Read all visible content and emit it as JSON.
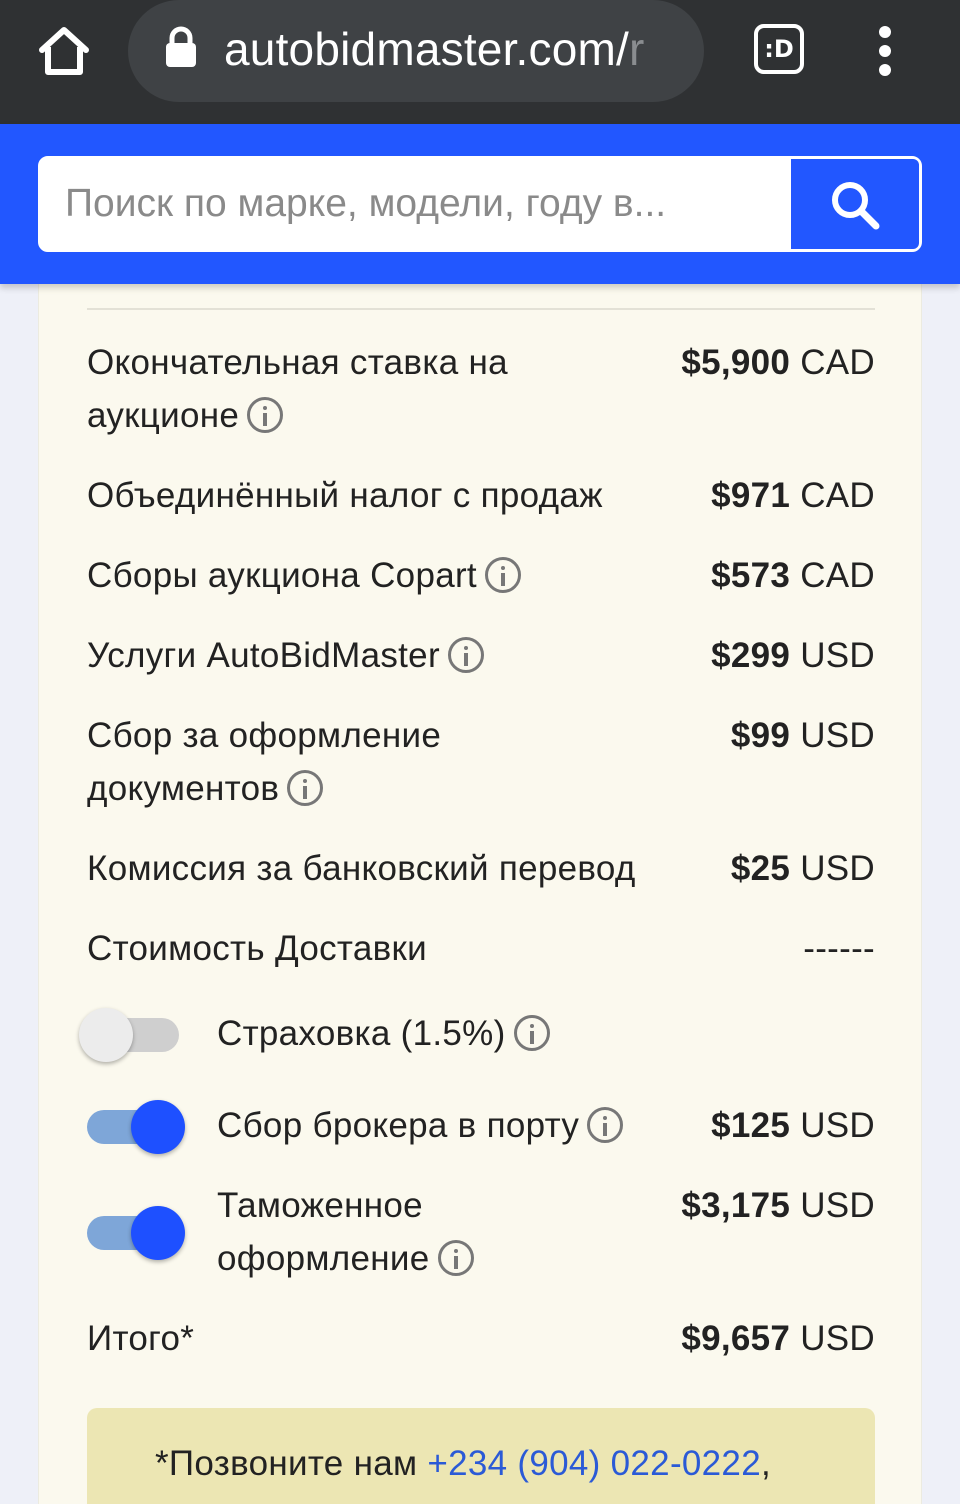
{
  "browser": {
    "url_main": "autobidmaster.com/",
    "url_fade": "r",
    "tabs_label": ":D"
  },
  "search": {
    "placeholder": "Поиск по марке, модели, году в..."
  },
  "costs": {
    "rows": [
      {
        "label": "Окончательная ставка на аукционе",
        "amount": "$5,900",
        "currency": "CAD",
        "info": true
      },
      {
        "label": "Объединённый налог с продаж",
        "amount": "$971",
        "currency": "CAD",
        "info": false
      },
      {
        "label": "Сборы аукциона Copart",
        "amount": "$573",
        "currency": "CAD",
        "info": true
      },
      {
        "label": "Услуги AutoBidMaster",
        "amount": "$299",
        "currency": "USD",
        "info": true
      },
      {
        "label": "Сбор за оформление документов",
        "amount": "$99",
        "currency": "USD",
        "info": true
      },
      {
        "label": "Комиссия за банковский перевод",
        "amount": "$25",
        "currency": "USD",
        "info": false
      },
      {
        "label": "Стоимость Доставки",
        "amount": "------",
        "currency": "",
        "info": false
      }
    ],
    "options": [
      {
        "label": "Страховка (1.5%)",
        "enabled": false,
        "amount": "",
        "currency": ""
      },
      {
        "label": "Сбор брокера в порту",
        "enabled": true,
        "amount": "$125",
        "currency": "USD"
      },
      {
        "label": "Таможенное оформление",
        "enabled": true,
        "amount": "$3,175",
        "currency": "USD"
      }
    ],
    "total": {
      "label": "Итого*",
      "amount": "$9,657",
      "currency": "USD"
    }
  },
  "note": {
    "prefix": "*Позвоните нам ",
    "phone": "+234 (904) 022-0222",
    "suffix": ","
  },
  "colors": {
    "header_blue": "#2257ff",
    "card_bg": "#fbf9ee",
    "note_bg": "#ece6b3",
    "toggle_on": "#1e50ff",
    "link": "#2b5ad6"
  }
}
